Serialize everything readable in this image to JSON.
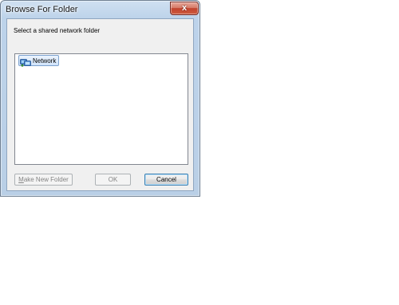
{
  "window": {
    "title": "Browse For Folder",
    "close_glyph": "x",
    "close_icon": "close-icon"
  },
  "dialog": {
    "description": "Select a shared network folder"
  },
  "tree": {
    "items": [
      {
        "label": "Network",
        "icon": "network-icon",
        "selected": true
      }
    ]
  },
  "buttons": {
    "make_new_folder": "Make New Folder",
    "ok": "OK",
    "cancel": "Cancel"
  },
  "colors": {
    "selection_border": "#7da2ce",
    "titlebar": "#bdd3ea",
    "close_button": "#c1432e"
  }
}
